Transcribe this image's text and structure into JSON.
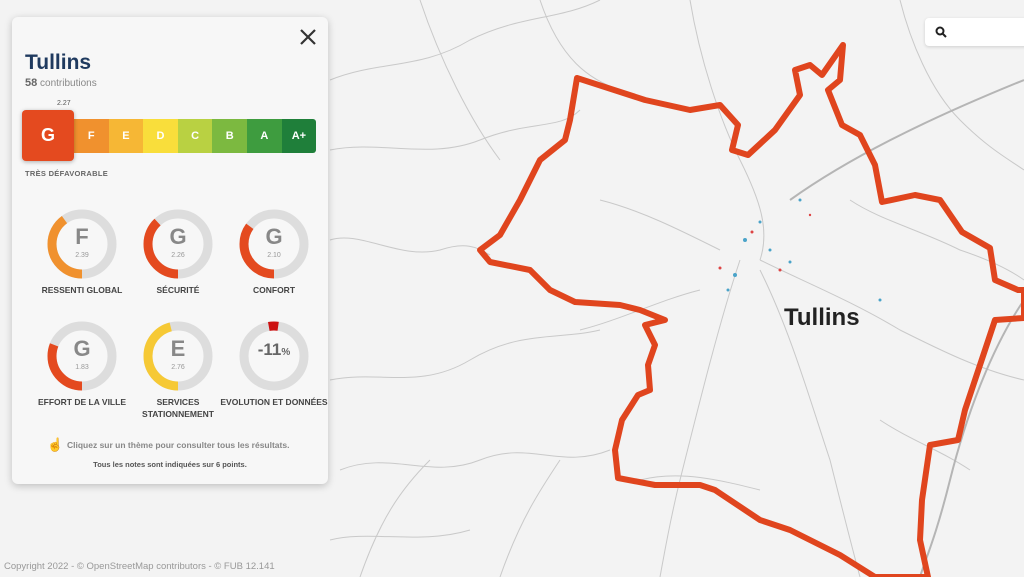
{
  "city": {
    "name": "Tullins",
    "contributions_count": "58",
    "contributions_label": "contributions",
    "overall_score": "2.27",
    "overall_grade": "G",
    "verdict": "TRÈS DÉFAVORABLE"
  },
  "grade_scale": [
    {
      "label": "F",
      "color": "#f0912e"
    },
    {
      "label": "E",
      "color": "#f6b735"
    },
    {
      "label": "D",
      "color": "#f9de3b"
    },
    {
      "label": "C",
      "color": "#b9d142"
    },
    {
      "label": "B",
      "color": "#7cb940"
    },
    {
      "label": "A",
      "color": "#3e9c3f"
    },
    {
      "label": "A+",
      "color": "#1f7f3a"
    }
  ],
  "themes": [
    {
      "grade": "F",
      "score": "2.39",
      "label": "RESSENTI GLOBAL",
      "color": "#f0912e",
      "fraction": 0.4
    },
    {
      "grade": "G",
      "score": "2.26",
      "label": "SÉCURITÉ",
      "color": "#e44a1f",
      "fraction": 0.38
    },
    {
      "grade": "G",
      "score": "2.10",
      "label": "CONFORT",
      "color": "#e44a1f",
      "fraction": 0.35
    },
    {
      "grade": "G",
      "score": "1.83",
      "label": "EFFORT DE LA VILLE",
      "color": "#e44a1f",
      "fraction": 0.31
    },
    {
      "grade": "E",
      "score": "2.76",
      "label": "SERVICES STATIONNEMENT",
      "color": "#f6c935",
      "fraction": 0.46
    },
    {
      "grade": "-11",
      "score": "%",
      "label": "EVOLUTION ET DONNÉES",
      "color": "#cc1111",
      "fraction": 0.05
    }
  ],
  "hint_text": "Cliquez sur un thème pour consulter tous les résultats.",
  "note_text": "Tous les notes sont indiquées sur 6 points.",
  "map": {
    "city_label": "Tullins",
    "attribution": "Copyright 2022 - © OpenStreetMap contributors - © FUB  12.141",
    "boundary_color": "#e0451e"
  },
  "icons": {
    "close": "close-icon",
    "search": "search-icon",
    "hint": "pointer-hand-icon"
  }
}
